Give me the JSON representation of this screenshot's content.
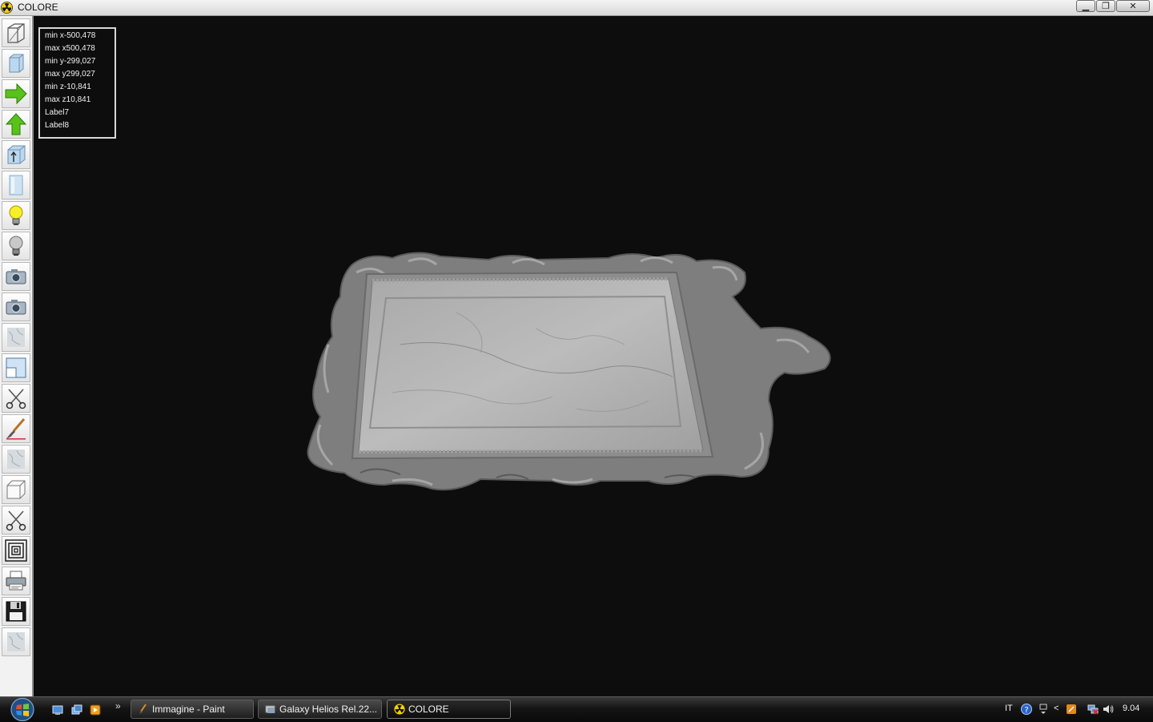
{
  "window": {
    "title": "COLORE",
    "controls": {
      "minimize": "▁",
      "maximize": "❐",
      "close": "✕"
    }
  },
  "toolbar": {
    "tools": [
      "wireframe-box-icon",
      "glass-cube-icon",
      "arrow-right-icon",
      "arrow-up-icon",
      "cube-arrow-up-icon",
      "glass-panel-icon",
      "light-bulb-on-icon",
      "light-bulb-off-icon",
      "camera-icon",
      "camera-icon",
      "marble-texture-icon",
      "panel-resize-icon",
      "scissors-icon",
      "paint-brush-icon",
      "marble-texture-icon",
      "cube-outline-icon",
      "scissors-icon",
      "concentric-squares-icon",
      "printer-icon",
      "floppy-disk-icon",
      "marble-texture-icon"
    ]
  },
  "info_panel": {
    "lines": [
      "min x-500,478",
      "max x500,478",
      "min y-299,027",
      "max y299,027",
      "min z-10,841",
      "max z10,841",
      "Label7",
      "Label8"
    ]
  },
  "taskbar": {
    "tasks": [
      {
        "label": "Immagine - Paint",
        "active": false
      },
      {
        "label": "Galaxy Helios  Rel.22...",
        "active": false
      },
      {
        "label": "COLORE",
        "active": true
      }
    ],
    "overflow_chevron": "»",
    "tray": {
      "language": "IT",
      "arrow": "<",
      "clock": "9.04"
    }
  },
  "colors": {
    "viewport_bg": "#0d0d0d",
    "frame": "#8a8a8a",
    "marble": "#b3b3b3",
    "taskbar": "#141414"
  }
}
